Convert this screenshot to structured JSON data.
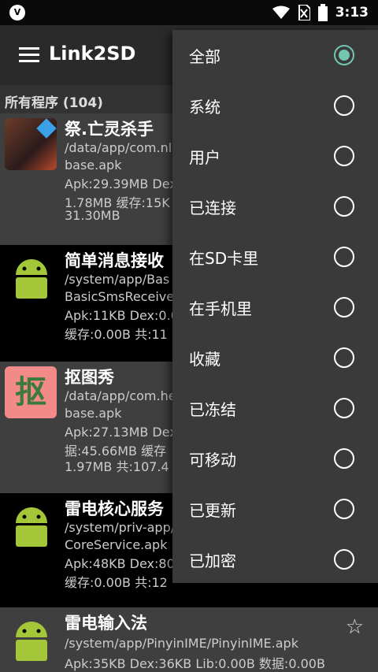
{
  "status_bar": {
    "time": "3:13",
    "notification_glyph": "V"
  },
  "app_bar": {
    "title": "Link2SD"
  },
  "section": {
    "label": "所有程序 (104)"
  },
  "apps": [
    {
      "name": "祭.亡灵杀手",
      "line1": "/data/app/com.nl",
      "line2": "base.apk",
      "line3": "Apk:29.39MB  Dex",
      "line4": "1.78MB  缓存:15K",
      "line5": "31.30MB"
    },
    {
      "name": "简单消息接收",
      "line1": "/system/app/Bas",
      "line2": "BasicSmsReceive",
      "line3": "Apk:11KB  Dex:0.0",
      "line4": "缓存:0.00B  共:11",
      "line5": ""
    },
    {
      "name": "抠图秀",
      "icon_text": "抠",
      "line1": "/data/app/com.he",
      "line2": "base.apk",
      "line3": "Apk:27.13MB  Dex",
      "line4": "据:45.66MB  缓存",
      "line5": "1.97MB  共:107.4"
    },
    {
      "name": "雷电核心服务",
      "line1": "/system/priv-app/",
      "line2": "CoreService.apk",
      "line3": "Apk:48KB  Dex:80",
      "line4": "缓存:0.00B  共:12",
      "line5": ""
    },
    {
      "name": "雷电输入法",
      "line1": "/system/app/PinyinIME/PinyinIME.apk",
      "line2": "Apk:35KB  Dex:36KB  Lib:0.00B  数据:0.00B",
      "line3": "",
      "line4": "",
      "line5": ""
    }
  ],
  "filter_menu": {
    "items": [
      {
        "label": "全部",
        "checked": true
      },
      {
        "label": "系统",
        "checked": false
      },
      {
        "label": "用户",
        "checked": false
      },
      {
        "label": "已连接",
        "checked": false
      },
      {
        "label": "在SD卡里",
        "checked": false
      },
      {
        "label": "在手机里",
        "checked": false
      },
      {
        "label": "收藏",
        "checked": false
      },
      {
        "label": "已冻结",
        "checked": false
      },
      {
        "label": "可移动",
        "checked": false
      },
      {
        "label": "已更新",
        "checked": false
      },
      {
        "label": "已加密",
        "checked": false
      }
    ]
  },
  "colors": {
    "accent": "#73c6b0",
    "menu_bg": "#3a3a3a",
    "app_bar": "#2a2a2a",
    "android_green": "#a4c639"
  },
  "icons": {
    "menu": "hamburger-icon",
    "star": "star-outline-icon",
    "radio": "radio-icon"
  }
}
